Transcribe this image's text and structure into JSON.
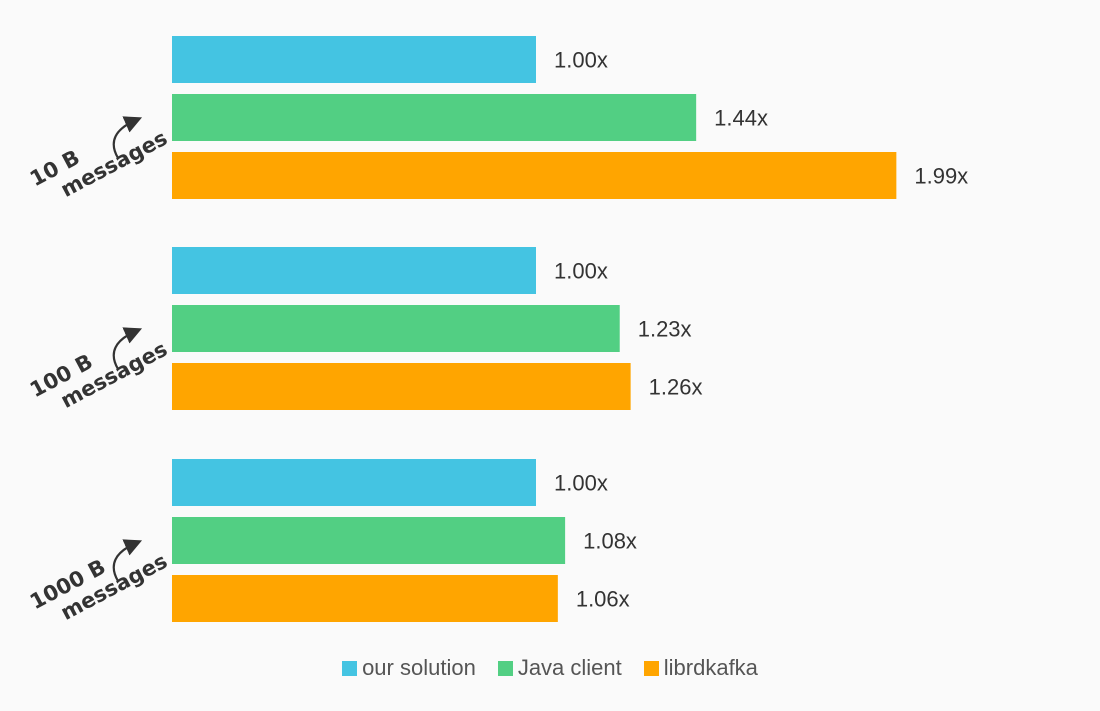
{
  "chart_data": {
    "type": "bar",
    "orientation": "horizontal",
    "title": "",
    "xlabel": "",
    "ylabel": "",
    "xlim": [
      0,
      2.0
    ],
    "grid": false,
    "legend_placement": "bottom-center",
    "categories": [
      "10 B messages",
      "100 B messages",
      "1000 B messages"
    ],
    "category_lines": [
      [
        "10 B",
        "messages"
      ],
      [
        "100 B",
        "messages"
      ],
      [
        "1000 B",
        "messages"
      ]
    ],
    "series": [
      {
        "name": "our solution",
        "color": "#44c4e2",
        "values": [
          1.0,
          1.0,
          1.0
        ],
        "labels": [
          "1.00x",
          "1.00x",
          "1.00x"
        ]
      },
      {
        "name": "Java client",
        "color": "#52cf83",
        "values": [
          1.44,
          1.23,
          1.08
        ],
        "labels": [
          "1.44x",
          "1.23x",
          "1.08x"
        ]
      },
      {
        "name": "librdkafka",
        "color": "#ffa500",
        "values": [
          1.99,
          1.26,
          1.06
        ],
        "labels": [
          "1.99x",
          "1.26x",
          "1.06x"
        ]
      }
    ]
  }
}
